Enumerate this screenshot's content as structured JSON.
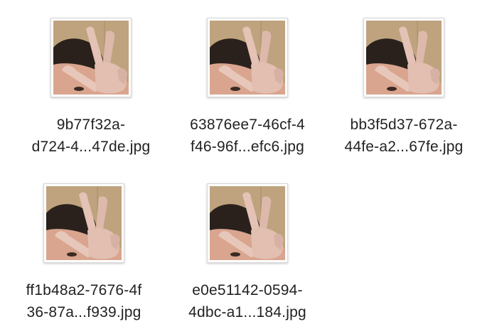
{
  "files": [
    {
      "name_line1": "9b77f32a-",
      "name_line2": "d724-4...47de.jpg",
      "thumbnail_icon": "photo-thumbnail-icon"
    },
    {
      "name_line1": "63876ee7-46cf-4",
      "name_line2": "f46-96f...efc6.jpg",
      "thumbnail_icon": "photo-thumbnail-icon"
    },
    {
      "name_line1": "bb3f5d37-672a-",
      "name_line2": "44fe-a2...67fe.jpg",
      "thumbnail_icon": "photo-thumbnail-icon"
    },
    {
      "name_line1": "ff1b48a2-7676-4f",
      "name_line2": "36-87a...f939.jpg",
      "thumbnail_icon": "photo-thumbnail-icon"
    },
    {
      "name_line1": "e0e51142-0594-",
      "name_line2": "4dbc-a1...184.jpg",
      "thumbnail_icon": "photo-thumbnail-icon"
    }
  ]
}
